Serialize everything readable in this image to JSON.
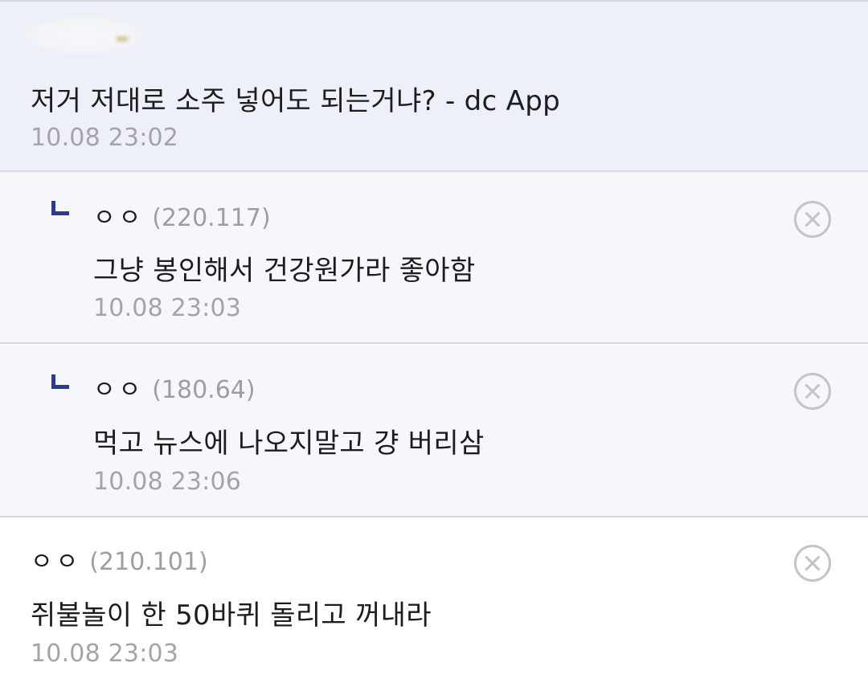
{
  "post_comment": {
    "text": "저거 저대로 소주 넣어도 되는거냐? - dc App",
    "time": "10.08 23:02"
  },
  "replies": [
    {
      "nick": "ㅇㅇ",
      "ip": "(220.117)",
      "text": "그냥 봉인해서 건강원가라 좋아함",
      "time": "10.08 23:03",
      "delete_icon": "circle-x-icon"
    },
    {
      "nick": "ㅇㅇ",
      "ip": "(180.64)",
      "text": "먹고 뉴스에 나오지말고 걍 버리삼",
      "time": "10.08 23:06",
      "delete_icon": "circle-x-icon"
    }
  ],
  "comment": {
    "nick": "ㅇㅇ",
    "ip": "(210.101)",
    "text": "쥐불놀이 한 50바퀴 돌리고 꺼내라",
    "time": "10.08 23:03",
    "delete_icon": "circle-x-icon"
  },
  "colors": {
    "highlight_bg": "#eef0f9",
    "reply_bg": "#f6f7fa",
    "reply_marker": "#2f3a8f",
    "timestamp": "#a3a3ab"
  }
}
